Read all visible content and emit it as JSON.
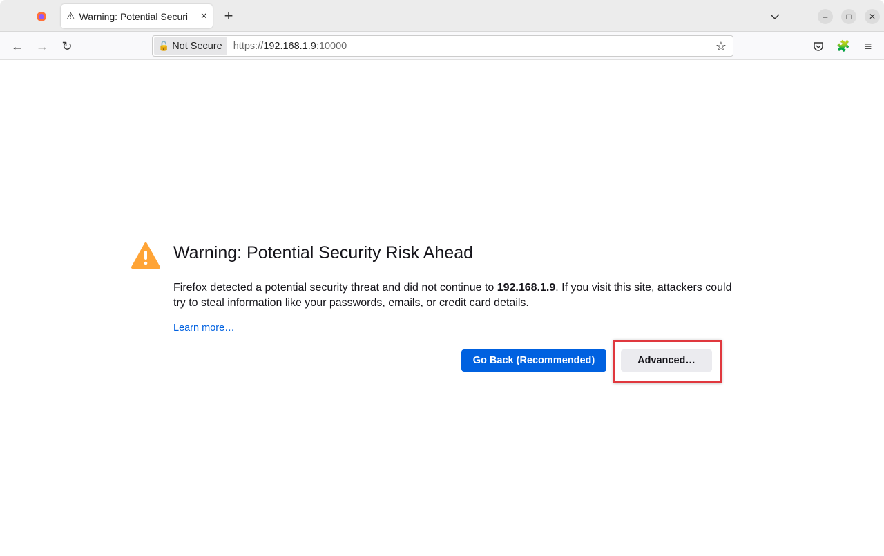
{
  "tab": {
    "title": "Warning: Potential Securi",
    "close": "×"
  },
  "new_tab": "+",
  "nav": {
    "back": "←",
    "forward": "→",
    "reload": "↻"
  },
  "urlbar": {
    "security_label": "Not Secure",
    "url_scheme": "https://",
    "url_host": "192.168.1.9",
    "url_port": ":10000"
  },
  "page": {
    "heading": "Warning: Potential Security Risk Ahead",
    "desc_before": "Firefox detected a potential security threat and did not continue to ",
    "desc_host": "192.168.1.9",
    "desc_after": ". If you visit this site, attackers could try to steal information like your passwords, emails, or credit card details.",
    "learn_more": "Learn more…",
    "go_back": "Go Back (Recommended)",
    "advanced": "Advanced…"
  },
  "colors": {
    "accent": "#0061e0",
    "warning": "#ffa436",
    "highlight": "#e0383e"
  }
}
